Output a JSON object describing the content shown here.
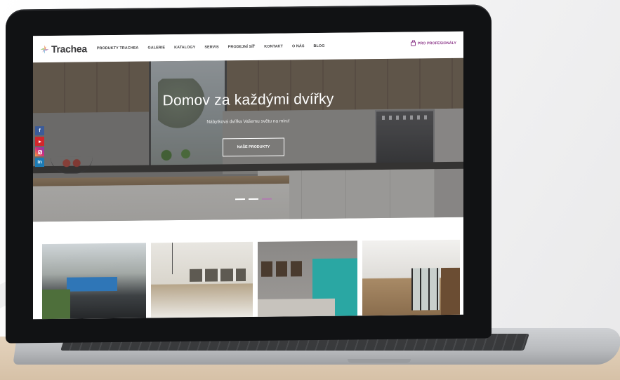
{
  "brand": {
    "name": "Trachea",
    "accent_color": "#8e3c8c"
  },
  "nav": {
    "items": [
      "PRODUKTY TRACHEA",
      "GALERIE",
      "KATALOGY",
      "SERVIS",
      "PRODEJNÍ SÍŤ",
      "KONTAKT",
      "O NÁS",
      "BLOG"
    ],
    "pro_link": "PRO PROFESIONÁLY",
    "pro_icon": "briefcase-icon"
  },
  "hero": {
    "title": "Domov za každými dvířky",
    "subtitle": "Nábytková dvířka Vašemu světu na míru!",
    "button": "NAŠE PRODUKTY",
    "slides": 3,
    "active_slide": 3
  },
  "social": {
    "facebook": "f",
    "youtube": "youtube-icon",
    "instagram": "instagram-icon",
    "linkedin": "in"
  },
  "gallery": {
    "items": [
      "kitchen-blue",
      "kitchen-white",
      "bedroom-teal",
      "kitchen-wood"
    ]
  }
}
